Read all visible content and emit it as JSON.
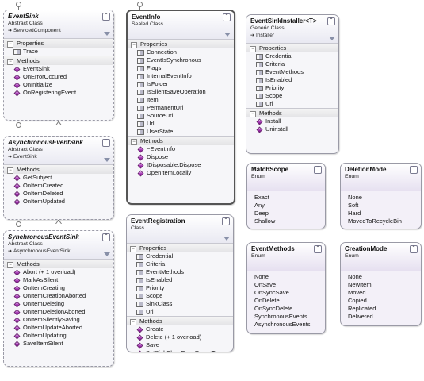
{
  "classes": {
    "event_sink": {
      "name": "EventSink",
      "stereotype": "Abstract Class",
      "base": "ServicedComponent",
      "sections": [
        {
          "label": "Properties",
          "kind": "prop",
          "items": [
            "Trace"
          ]
        },
        {
          "label": "Methods",
          "kind": "meth",
          "items": [
            "EventSink",
            "OnErrorOccured",
            "OnInitialize",
            "OnRegisteringEvent"
          ]
        }
      ]
    },
    "async_event_sink": {
      "name": "AsynchronousEventSink",
      "stereotype": "Abstract Class",
      "base": "EventSink",
      "sections": [
        {
          "label": "Methods",
          "kind": "meth",
          "items": [
            "GetSubject",
            "OnItemCreated",
            "OnItemDeleted",
            "OnItemUpdated"
          ]
        }
      ]
    },
    "sync_event_sink": {
      "name": "SynchronousEventSink",
      "stereotype": "Abstract Class",
      "base": "AsynchronousEventSink",
      "sections": [
        {
          "label": "Methods",
          "kind": "meth",
          "items": [
            "Abort (+ 1 overload)",
            "MarkAsSilent",
            "OnItemCreating",
            "OnItemCreationAborted",
            "OnItemDeleting",
            "OnItemDeletionAborted",
            "OnItemSilentlySaving",
            "OnItemUpdateAborted",
            "OnItemUpdating",
            "SaveItemSilent"
          ]
        }
      ]
    },
    "event_info": {
      "name": "EventInfo",
      "stereotype": "Sealed Class",
      "sections": [
        {
          "label": "Properties",
          "kind": "prop",
          "items": [
            "Connection",
            "EventIsSynchronous",
            "Flags",
            "InternalEventInfo",
            "IsFolder",
            "IsSilentSaveOperation",
            "Item",
            "PermanentUrl",
            "SourceUrl",
            "Url",
            "UserState"
          ]
        },
        {
          "label": "Methods",
          "kind": "meth",
          "items": [
            "~EventInfo",
            "Dispose",
            "IDisposable.Dispose",
            "OpenItemLocally"
          ]
        }
      ]
    },
    "event_registration": {
      "name": "EventRegistration",
      "stereotype": "Class",
      "sections": [
        {
          "label": "Properties",
          "kind": "prop",
          "items": [
            "Credential",
            "Criteria",
            "EventMethods",
            "IsEnabled",
            "Priority",
            "Scope",
            "SinkClass",
            "Url"
          ]
        },
        {
          "label": "Methods",
          "kind": "meth",
          "items": [
            "Create",
            "Delete (+ 1 overload)",
            "Save",
            "SetSinkClassFromType<T>"
          ]
        }
      ]
    },
    "event_sink_installer": {
      "name": "EventSinkInstaller<T>",
      "stereotype": "Generic Class",
      "base": "Installer",
      "sections": [
        {
          "label": "Properties",
          "kind": "prop",
          "items": [
            "Credential",
            "Criteria",
            "EventMethods",
            "IsEnabled",
            "Priority",
            "Scope",
            "Url"
          ]
        },
        {
          "label": "Methods",
          "kind": "meth",
          "items": [
            "Install",
            "Uninstall"
          ]
        }
      ]
    }
  },
  "enums": {
    "match_scope": {
      "name": "MatchScope",
      "stereotype": "Enum",
      "values": [
        "Exact",
        "Any",
        "Deep",
        "Shallow"
      ]
    },
    "deletion_mode": {
      "name": "DeletionMode",
      "stereotype": "Enum",
      "values": [
        "None",
        "Soft",
        "Hard",
        "MovedToRecycleBin"
      ]
    },
    "event_methods": {
      "name": "EventMethods",
      "stereotype": "Enum",
      "values": [
        "None",
        "OnSave",
        "OnSyncSave",
        "OnDelete",
        "OnSyncDelete",
        "SynchronousEvents",
        "AsynchronousEvents"
      ]
    },
    "creation_mode": {
      "name": "CreationMode",
      "stereotype": "Enum",
      "values": [
        "None",
        "NewItem",
        "Moved",
        "Copied",
        "Replicated",
        "Delivered"
      ]
    }
  },
  "icons": {
    "collapse": "collapse-chevron-icon",
    "filter": "filter-icon",
    "property": "property-icon",
    "method": "method-icon"
  }
}
